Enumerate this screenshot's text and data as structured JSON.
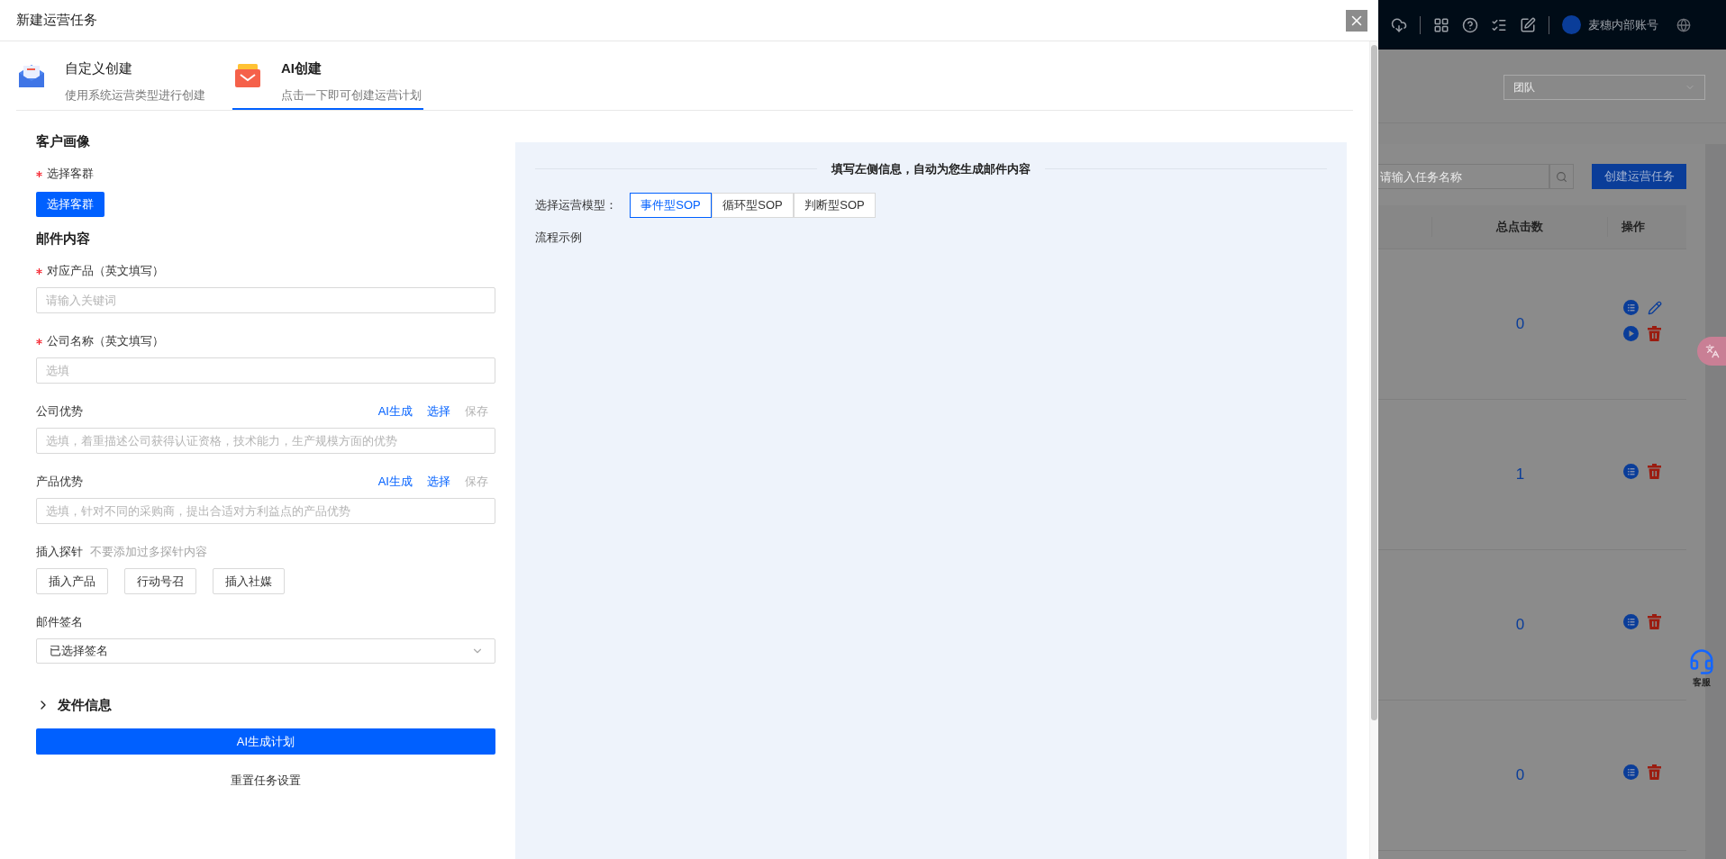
{
  "modal": {
    "title": "新建运营任务",
    "tabs": [
      {
        "title": "自定义创建",
        "subtitle": "使用系统运营类型进行创建",
        "selected": false
      },
      {
        "title": "AI创建",
        "subtitle": "点击一下即可创建运营计划",
        "selected": true
      }
    ],
    "form": [
      {
        "kind": "heading",
        "text": "客户画像"
      },
      {
        "kind": "picker",
        "label": "选择客群",
        "required": true,
        "button": "选择客群"
      },
      {
        "kind": "heading",
        "text": "邮件内容"
      },
      {
        "kind": "input",
        "label": "对应产品（英文填写）",
        "required": true,
        "placeholder": "请输入关键词"
      },
      {
        "kind": "input",
        "label": "公司名称（英文填写）",
        "required": true,
        "placeholder": "选填"
      },
      {
        "kind": "input",
        "label": "公司优势",
        "required": false,
        "placeholder": "选填，着重描述公司获得认证资格，技术能力，生产规模方面的优势",
        "actions": [
          {
            "label": "AI生成",
            "disabled": false
          },
          {
            "label": "选择",
            "disabled": false
          },
          {
            "label": "保存",
            "disabled": true
          }
        ]
      },
      {
        "kind": "input",
        "label": "产品优势",
        "required": false,
        "placeholder": "选填，针对不同的采购商，提出合适对方利益点的产品优势",
        "actions": [
          {
            "label": "AI生成",
            "disabled": false
          },
          {
            "label": "选择",
            "disabled": false
          },
          {
            "label": "保存",
            "disabled": true
          }
        ]
      },
      {
        "kind": "probe",
        "label": "插入探针",
        "hint": "不要添加过多探针内容",
        "buttons": [
          "插入产品",
          "行动号召",
          "插入社媒"
        ]
      },
      {
        "kind": "select",
        "label": "邮件签名",
        "value": "已选择签名"
      },
      {
        "kind": "collapse",
        "label": "发件信息",
        "expanded": false
      },
      {
        "kind": "primary",
        "label": "AI生成计划"
      },
      {
        "kind": "plain",
        "label": "重置任务设置"
      }
    ],
    "preview": {
      "heading": "填写左侧信息，自动为您生成邮件内容",
      "model_label": "选择运营模型：",
      "models": [
        {
          "label": "事件型SOP",
          "selected": true
        },
        {
          "label": "循环型SOP",
          "selected": false
        },
        {
          "label": "判断型SOP",
          "selected": false
        }
      ],
      "example_label": "流程示例"
    }
  },
  "background_page": {
    "account": "麦穗内部账号",
    "team_select": {
      "placeholder": "团队"
    },
    "search": {
      "placeholder": "请输入任务名称"
    },
    "create_button": "创建运营任务",
    "table": {
      "columns": [
        "总点击数",
        "操作"
      ],
      "rows": [
        {
          "clicks": "0",
          "kind": "full"
        },
        {
          "clicks": "1",
          "kind": "basic"
        },
        {
          "clicks": "0",
          "kind": "basic"
        },
        {
          "clicks": "0",
          "kind": "basic"
        }
      ]
    },
    "support": {
      "label": "客服"
    }
  }
}
